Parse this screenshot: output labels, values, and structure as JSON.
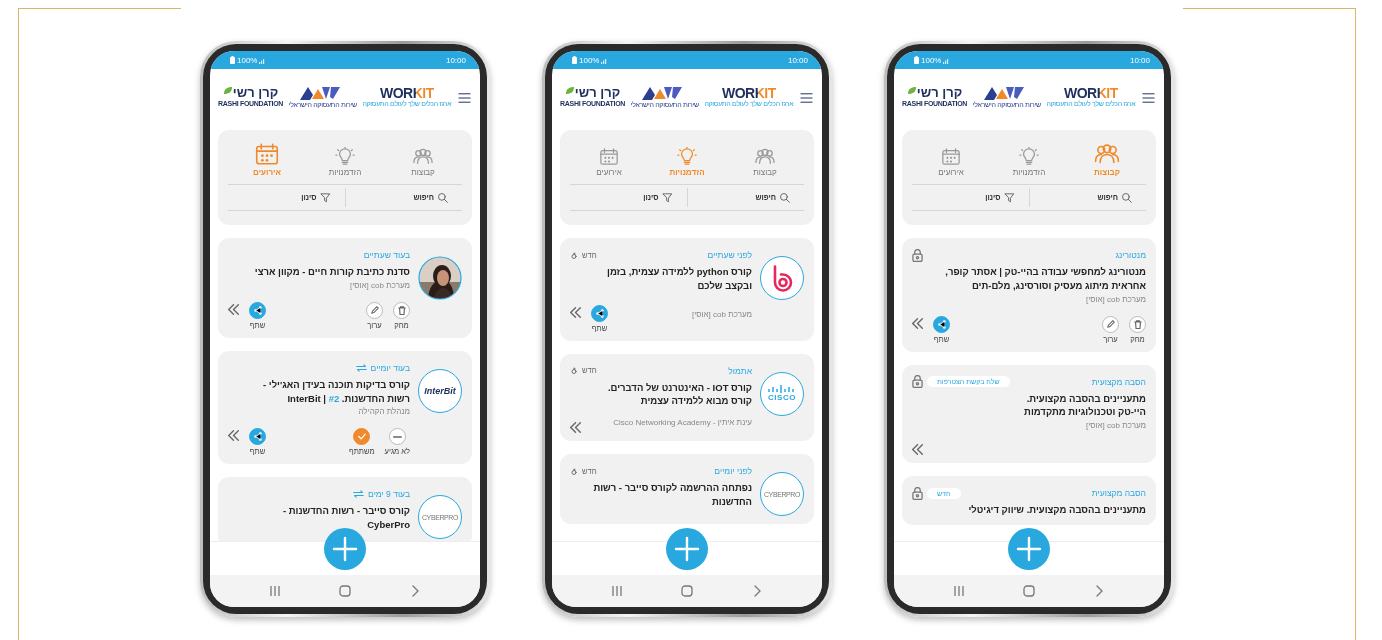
{
  "phones": [
    {
      "status": {
        "battery": "100%",
        "time": "10:00"
      },
      "header": {
        "logos": [
          {
            "kind": "workit",
            "text": "WORKIT",
            "caption": "ארגז הכלים שלך לעולם התעסוקה"
          },
          {
            "kind": "service",
            "caption": "שירות התעסוקה הישראלי"
          },
          {
            "kind": "rashi",
            "text": "קרן רשי",
            "caption": "RASHI FOUNDATION"
          }
        ]
      },
      "tabs": [
        {
          "kind": "groups",
          "label": "קבוצות",
          "selected": true
        },
        {
          "kind": "opportunities",
          "label": "הזדמנויות",
          "selected": false
        },
        {
          "kind": "events",
          "label": "אירועים",
          "selected": false
        }
      ],
      "search": "חיפוש",
      "filter": "סינון",
      "cards": [
        {
          "locked": true,
          "caption": "מנטורינג",
          "title": "מנטורינג למחפשי עבודה בהיי-טק | אסתר קופר,\nאחראית מיתוג מעסיק וסורסינג, מלם-תים",
          "subtitle": "מערכת cob [אוסי]",
          "actions": [
            {
              "kind": "delete",
              "label": "מחק"
            },
            {
              "kind": "edit",
              "label": "ערוך"
            }
          ],
          "share": "שתף",
          "expand": true
        },
        {
          "locked": true,
          "caption": "הסבה מקצועית",
          "badge": {
            "kind": "pill",
            "text": "שלח בקשת הצטרפות"
          },
          "title": "מתעניינים בהסבה מקצועית.\nהיי-טק וטכנולוגיות מתקדמות",
          "subtitle": "מערכת cob [אוסי]",
          "expand": true
        },
        {
          "locked": true,
          "caption": "הסבה מקצועית",
          "badge": {
            "kind": "pill",
            "text": "חדש"
          },
          "title": "מתעניינים בהסבה מקצועית. שיווק דיגיטלי"
        }
      ]
    },
    {
      "status": {
        "battery": "100%",
        "time": "10:00"
      },
      "header": {
        "logos": [
          {
            "kind": "workit",
            "text": "WORKIT",
            "caption": "ארגז הכלים שלך לעולם התעסוקה"
          },
          {
            "kind": "service",
            "caption": "שירות התעסוקה הישראלי"
          },
          {
            "kind": "rashi",
            "text": "קרן רשי",
            "caption": "RASHI FOUNDATION"
          }
        ]
      },
      "tabs": [
        {
          "kind": "groups",
          "label": "קבוצות",
          "selected": false
        },
        {
          "kind": "opportunities",
          "label": "הזדמנויות",
          "selected": true
        },
        {
          "kind": "events",
          "label": "אירועים",
          "selected": false
        }
      ],
      "search": "חיפוש",
      "filter": "סינון",
      "cards": [
        {
          "avatar": {
            "kind": "loop"
          },
          "caption": "לפני שעתיים",
          "badge": {
            "kind": "new",
            "text": "חדש"
          },
          "title": "קורס python ללמידה עצמית, בזמן\nובקצב שלכם",
          "footer": "מערכת cob [אוסי]",
          "share": "שתף",
          "expand": true
        },
        {
          "avatar": {
            "kind": "bars",
            "text": "CISCO"
          },
          "caption": "אתמול",
          "badge": {
            "kind": "new",
            "text": "חדש"
          },
          "title": "קורס IOT - האינטרנט של הדברים.\nקורס מבוא ללמידה עצמית",
          "footer": "עינת איתין - Cisco Networking Academy",
          "expand": true
        },
        {
          "avatar": {
            "kind": "smallmark",
            "text": "CYBERPRO"
          },
          "caption": "לפני יומיים",
          "badge": {
            "kind": "new",
            "text": "חדש"
          },
          "title": "נפתחה ההרשמה לקורס סייבר - רשות\nהחדשנות"
        }
      ]
    },
    {
      "status": {
        "battery": "100%",
        "time": "10:00"
      },
      "header": {
        "logos": [
          {
            "kind": "workit",
            "text": "WORKIT",
            "caption": "ארגז הכלים שלך לעולם התעסוקה"
          },
          {
            "kind": "service",
            "caption": "שירות התעסוקה הישראלי"
          },
          {
            "kind": "rashi",
            "text": "קרן רשי",
            "caption": "RASHI FOUNDATION"
          }
        ]
      },
      "tabs": [
        {
          "kind": "groups",
          "label": "קבוצות",
          "selected": false
        },
        {
          "kind": "opportunities",
          "label": "הזדמנויות",
          "selected": false
        },
        {
          "kind": "events",
          "label": "אירועים",
          "selected": true
        }
      ],
      "search": "חיפוש",
      "filter": "סינון",
      "cards": [
        {
          "avatar": {
            "kind": "picture"
          },
          "caption": "בעוד שעתיים",
          "recurring": false,
          "title": "סדנת כתיבת קורות חיים - מקוון ארצי",
          "subtitle": "מערכת cob [אוסי]",
          "actions": [
            {
              "kind": "delete",
              "label": "מחק"
            },
            {
              "kind": "edit",
              "label": "ערוך"
            }
          ],
          "share": "שתף",
          "expand": true
        },
        {
          "avatar": {
            "kind": "wordmark",
            "text": "InterBit"
          },
          "caption": "בעוד יומיים",
          "recurring": true,
          "title": "קורס בדיקות תוכנה בעידן האג'ילי -\nרשות החדשנות. InterBit |",
          "title_link": "#2",
          "subtitle": "מנהלת הקהילה",
          "actions": [
            {
              "kind": "decline",
              "label": "לא מגיע",
              "selected": false
            },
            {
              "kind": "attend",
              "label": "משתתף",
              "selected": true
            }
          ],
          "share": "שתף",
          "expand": true
        },
        {
          "avatar": {
            "kind": "smallmark",
            "text": "CYBERPRO"
          },
          "caption": "בעוד 9 ימים",
          "recurring": true,
          "title": "קורס סייבר - רשות החדשנות -\nCyberPro"
        }
      ]
    }
  ]
}
